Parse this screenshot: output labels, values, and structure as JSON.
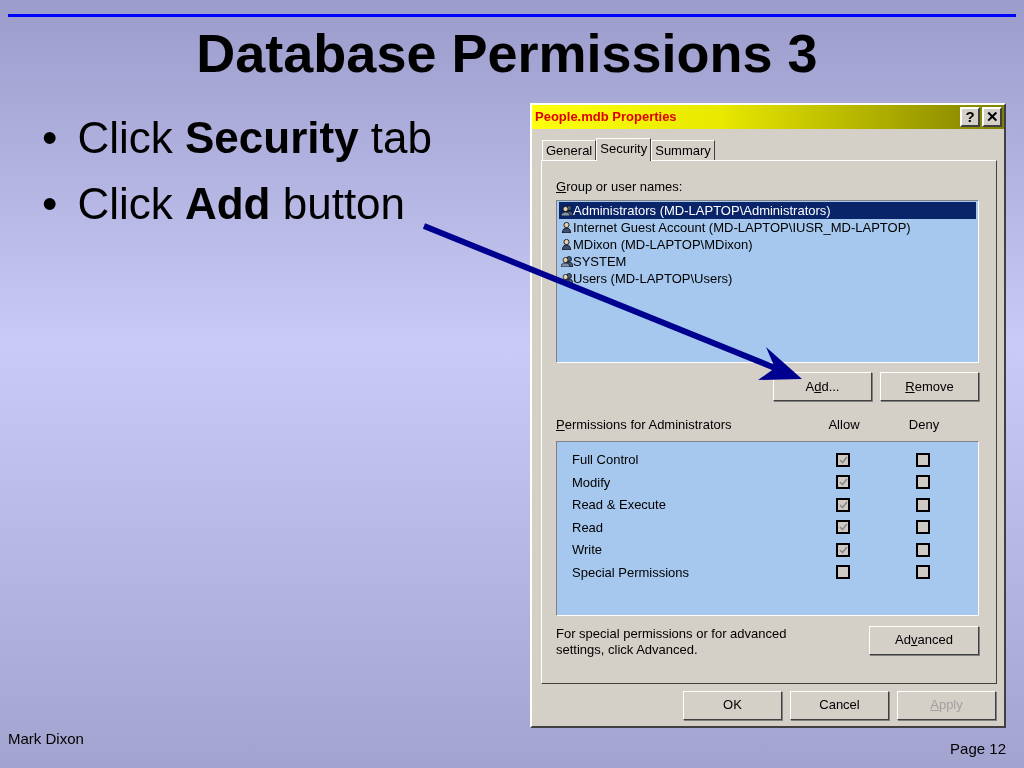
{
  "slide": {
    "title": "Database Permissions 3",
    "bullets": [
      {
        "bullet": "•",
        "text": "Click **Security** tab"
      },
      {
        "bullet": "•",
        "text": "Click **Add** button"
      }
    ],
    "footer_left": "Mark Dixon",
    "footer_right": "Page 12"
  },
  "dialog": {
    "title": "People.mdb Properties",
    "title_buttons": [
      "?",
      "✕"
    ],
    "tabs": [
      {
        "label": "General",
        "selected": false
      },
      {
        "label": "Security",
        "selected": true
      },
      {
        "label": "Summary",
        "selected": false
      }
    ],
    "group_label": [
      {
        "text": "G",
        "underlined": true
      },
      {
        "text": "roup or user names:",
        "underlined": false
      }
    ],
    "principals": [
      {
        "name": "Administrators (MD-LAPTOP\\Administrators)",
        "kind": "group",
        "selected": true
      },
      {
        "name": "Internet Guest Account (MD-LAPTOP\\IUSR_MD-LAPTOP)",
        "kind": "user",
        "selected": false
      },
      {
        "name": "MDixon (MD-LAPTOP\\MDixon)",
        "kind": "user",
        "selected": false
      },
      {
        "name": "SYSTEM",
        "kind": "group",
        "selected": false
      },
      {
        "name": "Users (MD-LAPTOP\\Users)",
        "kind": "group",
        "selected": false
      }
    ],
    "list_buttons": [
      [
        {
          "text": "A",
          "underlined": false
        },
        {
          "text": "d",
          "underlined": true
        },
        {
          "text": "d...",
          "underlined": false
        }
      ],
      [
        {
          "text": "R",
          "underlined": true
        },
        {
          "text": "emove",
          "underlined": false
        }
      ]
    ],
    "permissions_label": [
      {
        "text": "P",
        "underlined": true
      },
      {
        "text": "ermissions for Administrators",
        "underlined": false
      }
    ],
    "columns": [
      "Allow",
      "Deny"
    ],
    "permissions": [
      {
        "name": "Full Control",
        "allow": true,
        "deny": false
      },
      {
        "name": "Modify",
        "allow": true,
        "deny": false
      },
      {
        "name": "Read & Execute",
        "allow": true,
        "deny": false
      },
      {
        "name": "Read",
        "allow": true,
        "deny": false
      },
      {
        "name": "Write",
        "allow": true,
        "deny": false
      },
      {
        "name": "Special Permissions",
        "allow": false,
        "deny": false
      }
    ],
    "advanced_text": "For special permissions or for advanced settings, click Advanced.",
    "advanced_button": [
      {
        "text": "Ad",
        "underlined": false
      },
      {
        "text": "v",
        "underlined": true
      },
      {
        "text": "anced",
        "underlined": false
      }
    ],
    "buttons": [
      {
        "label": [
          {
            "text": "OK",
            "underlined": false
          }
        ],
        "disabled": false
      },
      {
        "label": [
          {
            "text": "Cancel",
            "underlined": false
          }
        ],
        "disabled": false
      },
      {
        "label": [
          {
            "text": "A",
            "underlined": true
          },
          {
            "text": "pply",
            "underlined": false
          }
        ],
        "disabled": true
      }
    ]
  }
}
